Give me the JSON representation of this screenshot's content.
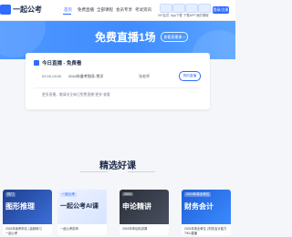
{
  "header": {
    "logo_text": "一起公考",
    "nav": [
      "首页",
      "免费直播",
      "全部课程",
      "会员专享",
      "考试资讯"
    ],
    "icons": [
      {
        "label": "VIP会员",
        "icon": "vip-icon"
      },
      {
        "label": "App下载",
        "icon": "app-icon"
      },
      {
        "label": "下载APP",
        "icon": "download-icon"
      },
      {
        "label": "我的课程",
        "icon": "my-course-icon"
      }
    ],
    "login_label": "登录/注册"
  },
  "hero": {
    "title": "免费直播1场",
    "button_label": "查看直播课 >"
  },
  "live_card": {
    "title": "今日直播 - 免费看",
    "rows": [
      {
        "time": "02:00-03:00",
        "course": "2024年备考指导-常识",
        "teacher": "张老师",
        "button": "预约直播"
      }
    ],
    "notice": "更多直播，敬请关注每日免费直播“更多”查看"
  },
  "section": {
    "title": "精选好课"
  },
  "courses": [
    {
      "badge": "热门",
      "thumb_text": "图形推理",
      "caption": "2024年省考申论 | 高频练习",
      "caption2": "一起公考",
      "color_from": "#1f3f8f",
      "color_to": "#3a6fd8"
    },
    {
      "badge": "一起公考",
      "thumb_text": "一起公考AI课",
      "caption": "一起公考讲师",
      "caption2": "",
      "color_from": "#eef3ff",
      "color_to": "#d8e4ff"
    },
    {
      "badge": "2024",
      "thumb_text": "申论精讲",
      "caption": "2024年申论精讲课",
      "caption2": "",
      "color_from": "#2a2f3a",
      "color_to": "#4a5060"
    },
    {
      "badge": "2024年事业单位",
      "thumb_text": "财务会计",
      "caption": "2024年事业单位 | 财务会计能力",
      "caption2": "TIKU直播",
      "color_from": "#1f5fd6",
      "color_to": "#3b8bff"
    }
  ],
  "colors": {
    "accent": "#2f6bff",
    "hero": "#4e97ff",
    "background": "#f4f6f9"
  }
}
